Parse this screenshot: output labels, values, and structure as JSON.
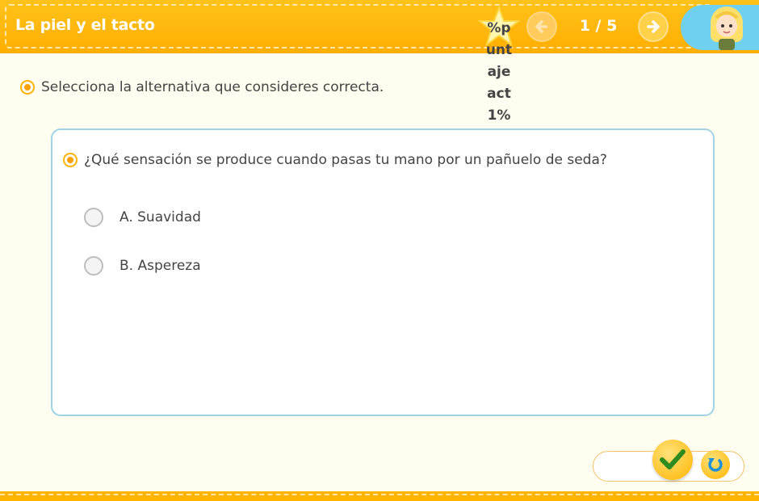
{
  "header": {
    "title": "La piel y el tacto",
    "score_text": "%puntajeact1%",
    "counter": "1 / 5"
  },
  "instruction": "Selecciona la alternativa que consideres correcta.",
  "question": {
    "text": "¿Qué sensación se produce cuando pasas tu mano por un pañuelo de seda?",
    "options": [
      {
        "label": "A. Suavidad",
        "selected": false
      },
      {
        "label": "B. Aspereza",
        "selected": false
      }
    ]
  },
  "icons": {
    "score": "star-icon",
    "prev": "arrow-left-icon",
    "next": "arrow-right-icon",
    "avatar": "avatar-icon",
    "bullet": "radio-dot-icon",
    "check": "check-icon",
    "reset": "reset-icon"
  },
  "colors": {
    "header": "#ffb400",
    "accent": "#ffa000",
    "card_border": "#9fd4e4",
    "check": "#2e8b1f",
    "reset": "#1f8fd8"
  }
}
